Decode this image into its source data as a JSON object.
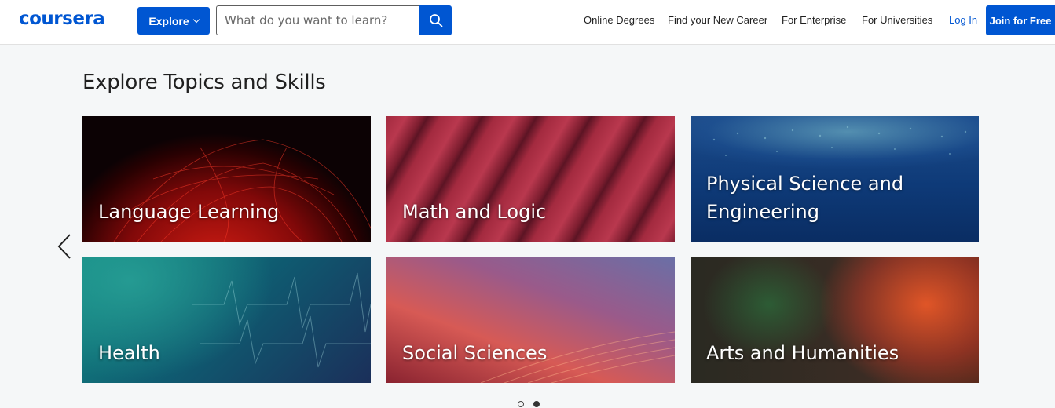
{
  "header": {
    "logo": "coursera",
    "explore_label": "Explore",
    "search": {
      "placeholder": "What do you want to learn?"
    },
    "nav": [
      "Online Degrees",
      "Find your New Career",
      "For Enterprise",
      "For Universities"
    ],
    "login_label": "Log In",
    "join_label": "Join for Free"
  },
  "main": {
    "section_title": "Explore Topics and Skills",
    "topics": [
      {
        "label": "Language Learning"
      },
      {
        "label": "Math and Logic"
      },
      {
        "label": "Physical Science and Engineering"
      },
      {
        "label": "Health"
      },
      {
        "label": "Social Sciences"
      },
      {
        "label": "Arts and Humanities"
      }
    ],
    "carousel": {
      "page_count": 2,
      "active_page": 2
    }
  },
  "colors": {
    "brand": "#0056d2",
    "background": "#f5f7f8"
  }
}
